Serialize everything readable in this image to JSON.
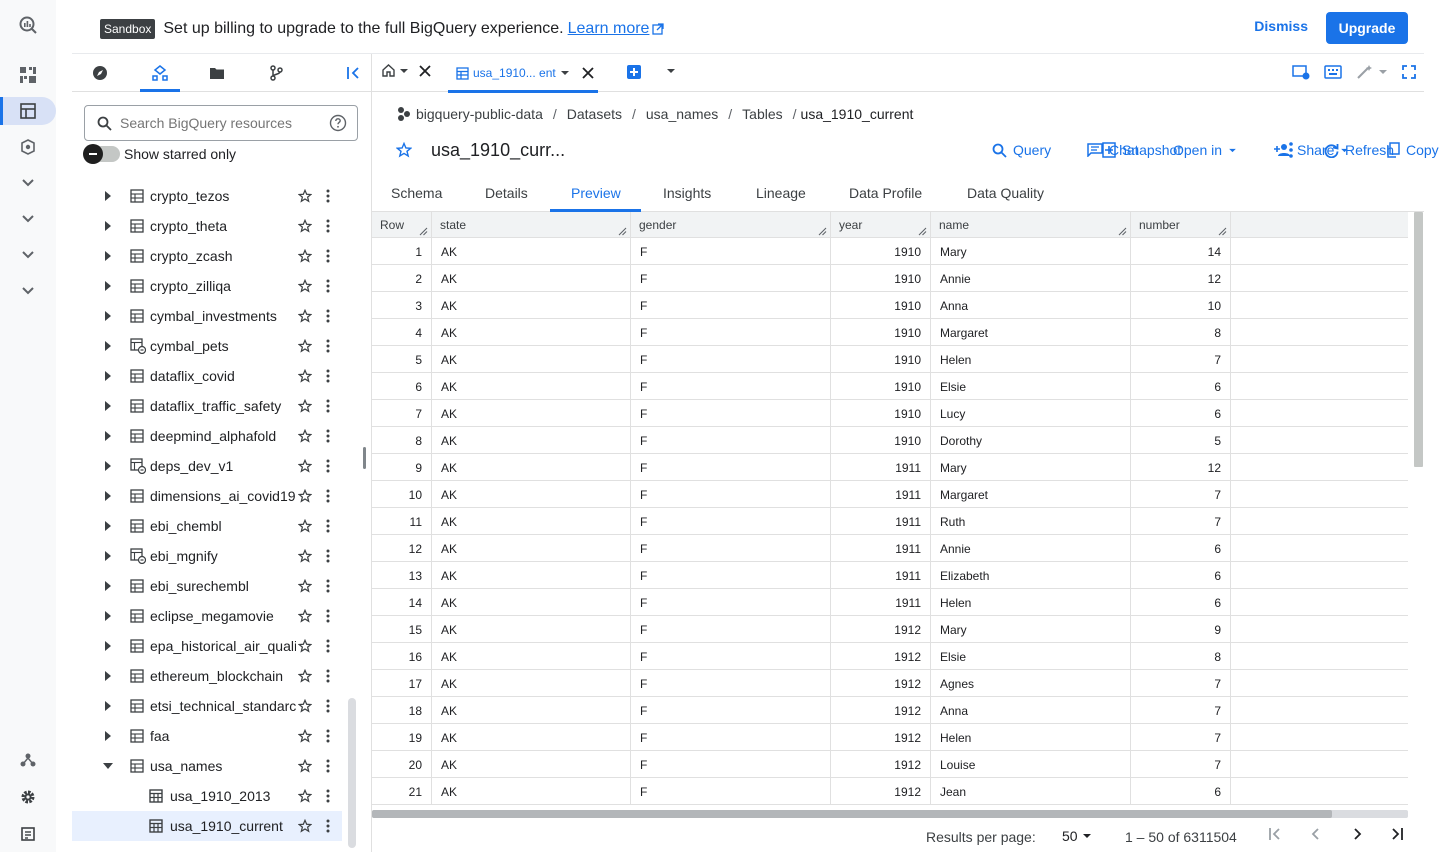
{
  "banner": {
    "chip": "Sandbox",
    "message": "Set up billing to upgrade to the full BigQuery experience.",
    "learn_more": "Learn more",
    "dismiss": "Dismiss",
    "upgrade": "Upgrade"
  },
  "explorer": {
    "search_placeholder": "Search BigQuery resources",
    "starred_label": "Show starred only",
    "datasets": [
      {
        "label": "crypto_tezos",
        "icon": "dataset-icon"
      },
      {
        "label": "crypto_theta",
        "icon": "dataset-icon"
      },
      {
        "label": "crypto_zcash",
        "icon": "dataset-icon"
      },
      {
        "label": "crypto_zilliqa",
        "icon": "dataset-icon"
      },
      {
        "label": "cymbal_investments",
        "icon": "dataset-icon"
      },
      {
        "label": "cymbal_pets",
        "icon": "linked-dataset-icon"
      },
      {
        "label": "dataflix_covid",
        "icon": "dataset-icon"
      },
      {
        "label": "dataflix_traffic_safety",
        "icon": "dataset-icon"
      },
      {
        "label": "deepmind_alphafold",
        "icon": "dataset-icon"
      },
      {
        "label": "deps_dev_v1",
        "icon": "linked-dataset-icon"
      },
      {
        "label": "dimensions_ai_covid19",
        "icon": "dataset-icon"
      },
      {
        "label": "ebi_chembl",
        "icon": "dataset-icon"
      },
      {
        "label": "ebi_mgnify",
        "icon": "linked-dataset-icon"
      },
      {
        "label": "ebi_surechembl",
        "icon": "dataset-icon"
      },
      {
        "label": "eclipse_megamovie",
        "icon": "dataset-icon"
      },
      {
        "label": "epa_historical_air_quali",
        "icon": "dataset-icon"
      },
      {
        "label": "ethereum_blockchain",
        "icon": "dataset-icon"
      },
      {
        "label": "etsi_technical_standarc",
        "icon": "dataset-icon"
      },
      {
        "label": "faa",
        "icon": "dataset-icon"
      },
      {
        "label": "usa_names",
        "icon": "dataset-icon",
        "expanded": true
      }
    ],
    "tables": [
      {
        "label": "usa_1910_2013"
      },
      {
        "label": "usa_1910_current",
        "selected": true
      }
    ]
  },
  "tabs": {
    "active_label": "usa_1910... ent"
  },
  "breadcrumb": {
    "project": "bigquery-public-data",
    "datasets": "Datasets",
    "dataset": "usa_names",
    "tables": "Tables",
    "table": "usa_1910_current",
    "sep": "/"
  },
  "table_title": "usa_1910_curr...",
  "actions": {
    "query": "Query",
    "chat": "Chat",
    "open_in": "Open in",
    "share": "Share",
    "copy": "Copy",
    "snapshot": "Snapshot",
    "refresh": "Refresh"
  },
  "subtabs": [
    "Schema",
    "Details",
    "Preview",
    "Insights",
    "Lineage",
    "Data Profile",
    "Data Quality"
  ],
  "grid": {
    "columns": [
      "Row",
      "state",
      "gender",
      "year",
      "name",
      "number"
    ],
    "rows": [
      [
        "1",
        "AK",
        "F",
        "1910",
        "Mary",
        "14"
      ],
      [
        "2",
        "AK",
        "F",
        "1910",
        "Annie",
        "12"
      ],
      [
        "3",
        "AK",
        "F",
        "1910",
        "Anna",
        "10"
      ],
      [
        "4",
        "AK",
        "F",
        "1910",
        "Margaret",
        "8"
      ],
      [
        "5",
        "AK",
        "F",
        "1910",
        "Helen",
        "7"
      ],
      [
        "6",
        "AK",
        "F",
        "1910",
        "Elsie",
        "6"
      ],
      [
        "7",
        "AK",
        "F",
        "1910",
        "Lucy",
        "6"
      ],
      [
        "8",
        "AK",
        "F",
        "1910",
        "Dorothy",
        "5"
      ],
      [
        "9",
        "AK",
        "F",
        "1911",
        "Mary",
        "12"
      ],
      [
        "10",
        "AK",
        "F",
        "1911",
        "Margaret",
        "7"
      ],
      [
        "11",
        "AK",
        "F",
        "1911",
        "Ruth",
        "7"
      ],
      [
        "12",
        "AK",
        "F",
        "1911",
        "Annie",
        "6"
      ],
      [
        "13",
        "AK",
        "F",
        "1911",
        "Elizabeth",
        "6"
      ],
      [
        "14",
        "AK",
        "F",
        "1911",
        "Helen",
        "6"
      ],
      [
        "15",
        "AK",
        "F",
        "1912",
        "Mary",
        "9"
      ],
      [
        "16",
        "AK",
        "F",
        "1912",
        "Elsie",
        "8"
      ],
      [
        "17",
        "AK",
        "F",
        "1912",
        "Agnes",
        "7"
      ],
      [
        "18",
        "AK",
        "F",
        "1912",
        "Anna",
        "7"
      ],
      [
        "19",
        "AK",
        "F",
        "1912",
        "Helen",
        "7"
      ],
      [
        "20",
        "AK",
        "F",
        "1912",
        "Louise",
        "7"
      ],
      [
        "21",
        "AK",
        "F",
        "1912",
        "Jean",
        "6"
      ]
    ]
  },
  "pager": {
    "label": "Results per page:",
    "per_page": "50",
    "range": "1 – 50 of 6311504"
  },
  "colors": {
    "accent": "#1a73e8",
    "selected_bg": "#e8f0fe"
  }
}
